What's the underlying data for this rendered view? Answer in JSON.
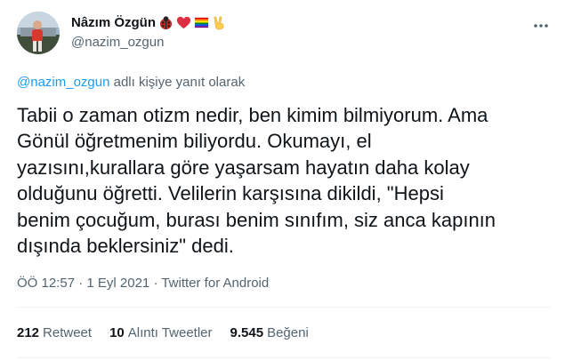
{
  "user": {
    "display_name": "Nâzım Özgün",
    "handle": "@nazim_ozgun",
    "name_emojis": [
      "ladybug-icon",
      "red-heart-icon",
      "rainbow-flag-icon",
      "victory-hand-icon"
    ]
  },
  "reply": {
    "mention": "@nazim_ozgun",
    "suffix": " adlı kişiye yanıt olarak"
  },
  "tweet": {
    "text": "Tabii o zaman otizm nedir, ben kimim bilmiyorum. Ama\nGönül öğretmenim biliyordu. Okumayı, el\nyazısını,kurallara göre yaşarsam hayatın daha kolay\nolduğunu öğretti. Velilerin karşısına dikildi, \"Hepsi\nbenim çocuğum, burası benim sınıfım, siz anca kapının\ndışında beklersiniz\" dedi."
  },
  "meta": {
    "time": "ÖÖ 12:57",
    "date": "1 Eyl 2021",
    "source": "Twitter for Android",
    "separator": " · "
  },
  "stats": {
    "retweets_count": "212",
    "retweets_label": "Retweet",
    "quotes_count": "10",
    "quotes_label": "Alıntı Tweetler",
    "likes_count": "9.545",
    "likes_label": "Beğeni"
  },
  "colors": {
    "text_primary": "#0f1419",
    "text_secondary": "#536471",
    "accent": "#1d9bf0",
    "divider": "#eff3f4"
  }
}
